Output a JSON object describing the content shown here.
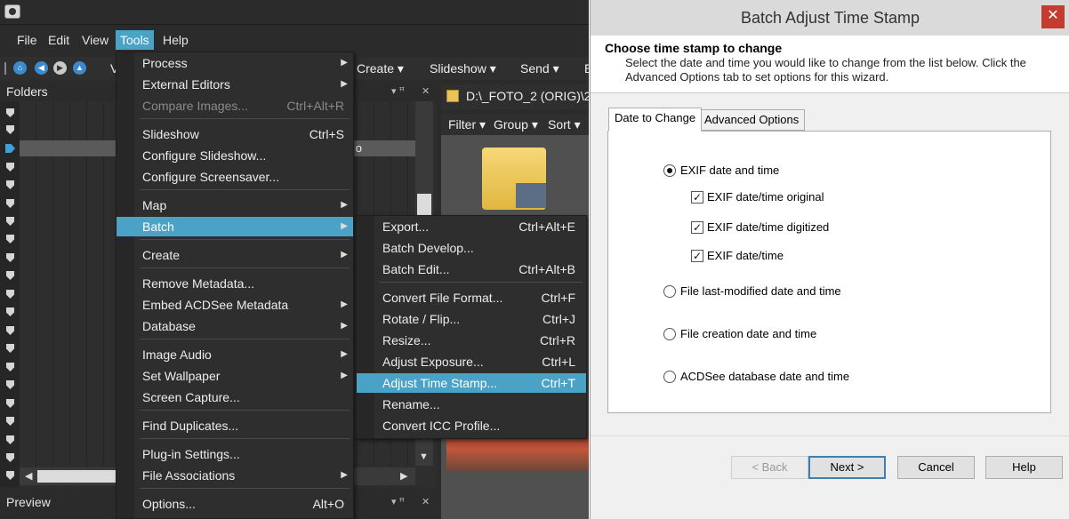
{
  "app": {
    "menubar": [
      "File",
      "Edit",
      "View",
      "Tools",
      "Help"
    ],
    "toolbar": {
      "items": [
        "Create",
        "Slideshow",
        "Send"
      ],
      "partial_left": "V",
      "partial_right": "E",
      "dropdown_glyph": "▾"
    },
    "folders_pane": {
      "title": "Folders",
      "pin": "▾ ꟸ",
      "close": "✕",
      "selected_row_suffix": "o"
    },
    "preview_pane": {
      "title": "Preview",
      "pin": "▾ ꟸ",
      "close": "✕"
    },
    "path": "D:\\_FOTO_2 (ORIG)\\2",
    "filter_bar": [
      "Filter",
      "Group",
      "Sort"
    ],
    "tools_menu": [
      {
        "label": "Process",
        "shortcut": "",
        "submenu": true
      },
      {
        "label": "External Editors",
        "shortcut": "",
        "submenu": true
      },
      {
        "label": "Compare Images...",
        "shortcut": "Ctrl+Alt+R",
        "disabled": true
      },
      {
        "label": "Slideshow",
        "shortcut": "Ctrl+S"
      },
      {
        "label": "Configure Slideshow...",
        "shortcut": ""
      },
      {
        "label": "Configure Screensaver...",
        "shortcut": ""
      },
      {
        "label": "Map",
        "shortcut": "",
        "submenu": true
      },
      {
        "label": "Batch",
        "shortcut": "",
        "submenu": true,
        "highlighted": true
      },
      {
        "label": "Create",
        "shortcut": "",
        "submenu": true
      },
      {
        "label": "Remove Metadata...",
        "shortcut": ""
      },
      {
        "label": "Embed ACDSee Metadata",
        "shortcut": "",
        "submenu": true
      },
      {
        "label": "Database",
        "shortcut": "",
        "submenu": true
      },
      {
        "label": "Image Audio",
        "shortcut": "",
        "submenu": true
      },
      {
        "label": "Set Wallpaper",
        "shortcut": "",
        "submenu": true
      },
      {
        "label": "Screen Capture...",
        "shortcut": ""
      },
      {
        "label": "Find Duplicates...",
        "shortcut": ""
      },
      {
        "label": "Plug-in Settings...",
        "shortcut": ""
      },
      {
        "label": "File Associations",
        "shortcut": "",
        "submenu": true
      },
      {
        "label": "Options...",
        "shortcut": "Alt+O"
      }
    ],
    "batch_menu": [
      {
        "label": "Export...",
        "shortcut": "Ctrl+Alt+E"
      },
      {
        "label": "Batch Develop...",
        "shortcut": ""
      },
      {
        "label": "Batch Edit...",
        "shortcut": "Ctrl+Alt+B"
      },
      {
        "label": "Convert File Format...",
        "shortcut": "Ctrl+F"
      },
      {
        "label": "Rotate / Flip...",
        "shortcut": "Ctrl+J"
      },
      {
        "label": "Resize...",
        "shortcut": "Ctrl+R"
      },
      {
        "label": "Adjust Exposure...",
        "shortcut": "Ctrl+L"
      },
      {
        "label": "Adjust Time Stamp...",
        "shortcut": "Ctrl+T",
        "highlighted": true
      },
      {
        "label": "Rename...",
        "shortcut": ""
      },
      {
        "label": "Convert ICC Profile...",
        "shortcut": ""
      }
    ],
    "accent_color": "#4aa3c7"
  },
  "dialog": {
    "title": "Batch Adjust Time Stamp",
    "close_glyph": "✕",
    "heading": "Choose time stamp to change",
    "description": "Select the date and time you would like to change from the list below. Click the Advanced Options tab to set options for this wizard.",
    "tabs": [
      "Date to Change",
      "Advanced Options"
    ],
    "selected_tab": "Date to Change",
    "options": {
      "exif": {
        "label": "EXIF date and time",
        "selected": true
      },
      "exif_original": {
        "label": "EXIF date/time original",
        "checked": true
      },
      "exif_digitized": {
        "label": "EXIF date/time digitized",
        "checked": true
      },
      "exif_datetime": {
        "label": "EXIF date/time",
        "checked": true
      },
      "file_modified": {
        "label": "File last-modified date and time",
        "selected": false
      },
      "file_created": {
        "label": "File creation date and time",
        "selected": false
      },
      "acdsee_db": {
        "label": "ACDSee database date and time",
        "selected": false
      }
    },
    "check_glyph": "✓",
    "buttons": {
      "back": "< Back",
      "next": "Next >",
      "cancel": "Cancel",
      "help": "Help"
    },
    "close_color": "#c43c2f"
  }
}
